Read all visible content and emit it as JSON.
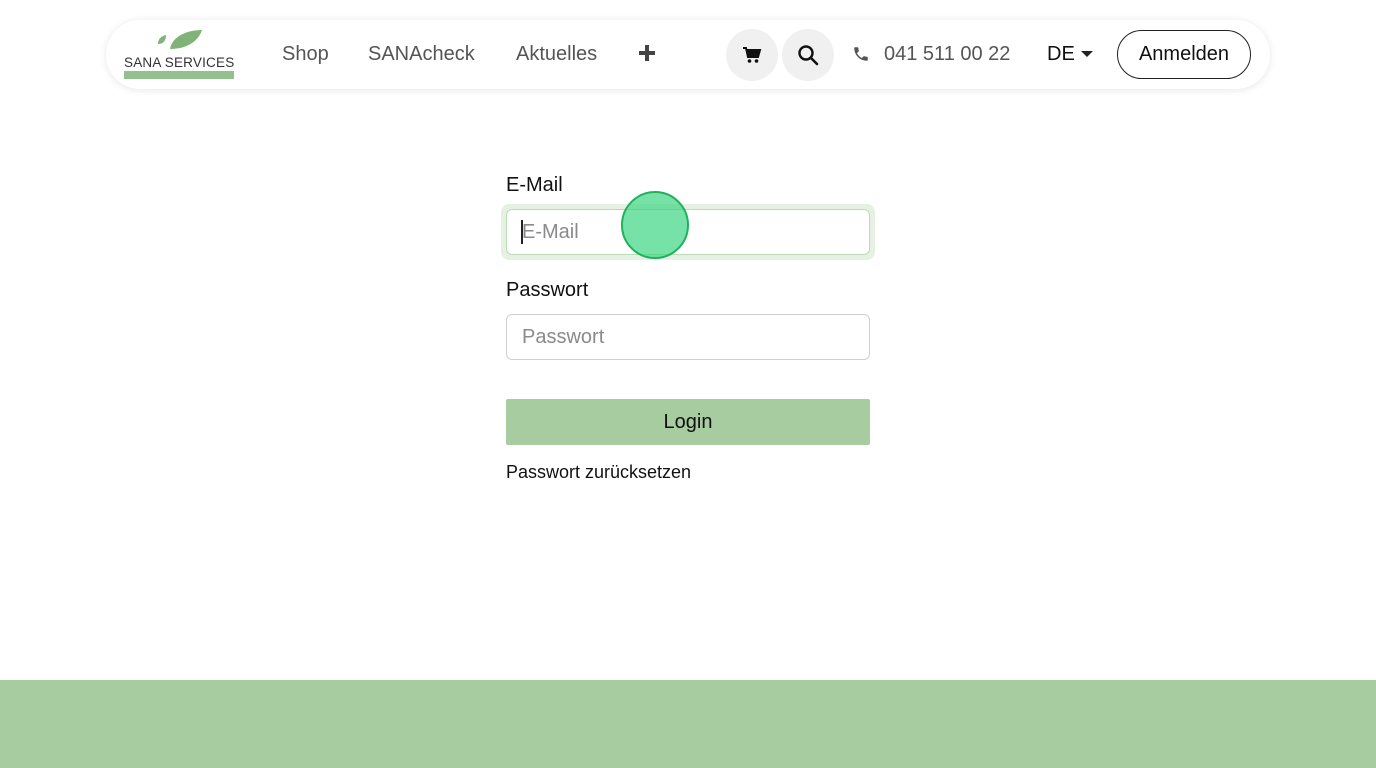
{
  "header": {
    "logo_text": "SANA SERVICES",
    "nav": [
      {
        "label": "Shop"
      },
      {
        "label": "SANAcheck"
      },
      {
        "label": "Aktuelles"
      }
    ],
    "more_icon": "plus-icon",
    "cart_icon": "cart-icon",
    "search_icon": "search-icon",
    "phone_icon": "phone-icon",
    "phone": "041 511 00 22",
    "language": "DE",
    "login_button": "Anmelden"
  },
  "form": {
    "email_label": "E-Mail",
    "email_placeholder": "E-Mail",
    "email_value": "",
    "password_label": "Passwort",
    "password_placeholder": "Passwort",
    "password_value": "",
    "submit_label": "Login",
    "reset_link": "Passwort zurücksetzen"
  },
  "colors": {
    "brand_green": "#a7cc9f",
    "logo_green": "#93c08f",
    "leaf_green": "#7fb377"
  }
}
